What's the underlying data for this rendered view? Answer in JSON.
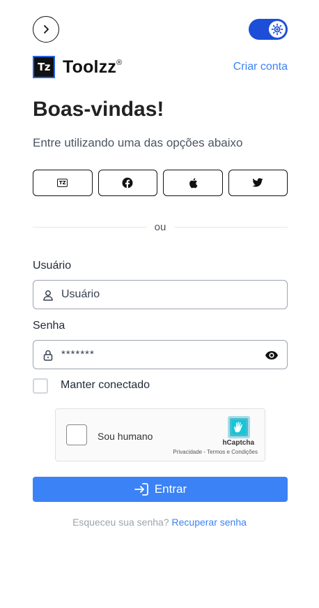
{
  "header": {
    "back_icon": "chevron-right-icon",
    "theme_toggle_icon": "sun-icon",
    "theme_toggle_on": true,
    "accent_color": "#1d4ed8"
  },
  "brand": {
    "logo_text": "Tz",
    "name": "Toolzz",
    "registered_mark": "®",
    "create_account_link": "Criar conta"
  },
  "main": {
    "title": "Boas-vindas!",
    "subtitle": "Entre utilizando uma das opções abaixo",
    "social_logins": [
      {
        "provider": "toolzz",
        "icon": "tz-icon",
        "icon_text": "TZ"
      },
      {
        "provider": "facebook",
        "icon": "facebook-icon"
      },
      {
        "provider": "apple",
        "icon": "apple-icon"
      },
      {
        "provider": "twitter",
        "icon": "twitter-icon"
      }
    ],
    "divider_text": "ou"
  },
  "form": {
    "username_label": "Usuário",
    "username_placeholder": "Usuário",
    "username_icon": "user-icon",
    "password_label": "Senha",
    "password_value": "*******",
    "password_icon": "lock-icon",
    "password_visibility_icon": "eye-icon",
    "remember_label": "Manter conectado",
    "remember_checked": false
  },
  "captcha": {
    "label": "Sou humano",
    "brand": "hCaptcha",
    "terms": "Privacidade - Termos e Condições"
  },
  "submit": {
    "label": "Entrar",
    "icon": "login-icon",
    "color": "#3b82f6"
  },
  "recover": {
    "prompt": "Esqueceu sua senha?",
    "link": "Recuperar senha"
  }
}
